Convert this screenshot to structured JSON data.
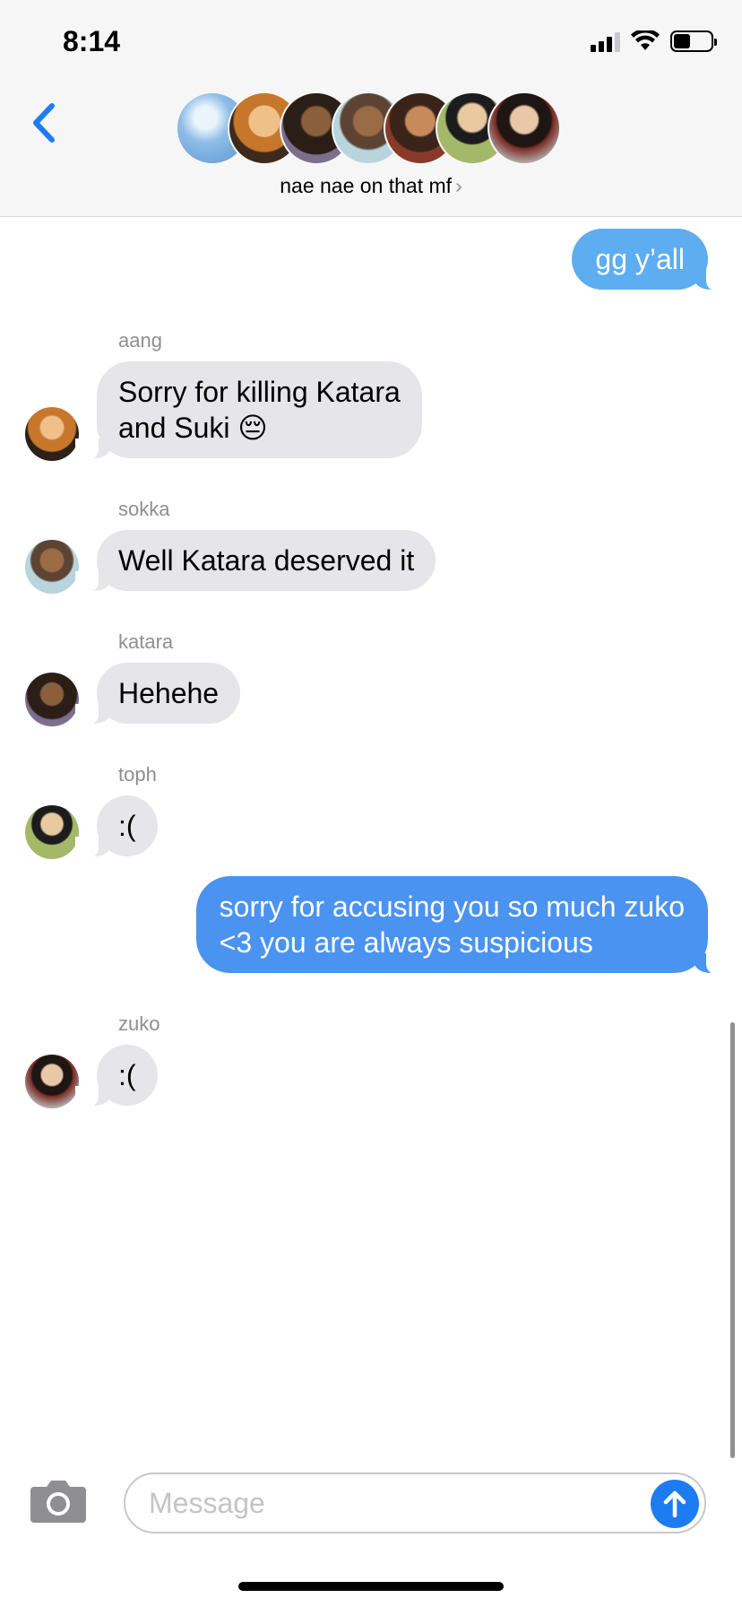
{
  "status_bar": {
    "time": "8:14"
  },
  "header": {
    "group_name": "nae nae on that mf",
    "group_chevron": "›",
    "avatar_colors": [
      "#a8cdee",
      "#c7772b",
      "#5d4a3a",
      "#6e9aa6",
      "#7a4e2c",
      "#6a7d3a",
      "#3b2a24"
    ]
  },
  "messages": [
    {
      "type": "out",
      "text": "gg y’all",
      "color": "#5dadf0"
    },
    {
      "type": "in",
      "sender": "aang",
      "text_lines": [
        "Sorry for killing Katara",
        "and Suki 😔"
      ],
      "avatar_color": "#c7772b"
    },
    {
      "type": "in",
      "sender": "sokka",
      "text": "Well Katara deserved it",
      "avatar_color": "#6e9aa6"
    },
    {
      "type": "in",
      "sender": "katara",
      "text": "Hehehe",
      "avatar_color": "#5d4a3a"
    },
    {
      "type": "in",
      "sender": "toph",
      "text": ":(",
      "avatar_color": "#6a7d3a"
    },
    {
      "type": "out",
      "text_lines": [
        "sorry for accusing you so much zuko",
        "<3 you are always suspicious"
      ],
      "color": "#4b93f0"
    },
    {
      "type": "in",
      "sender": "zuko",
      "text": ":(",
      "avatar_color": "#3b2a24"
    }
  ],
  "composer": {
    "placeholder": "Message"
  },
  "icons": {
    "back": "chevron-left-icon",
    "camera": "camera-icon",
    "send": "arrow-up-icon"
  },
  "accent_color": "#1e7cf2"
}
